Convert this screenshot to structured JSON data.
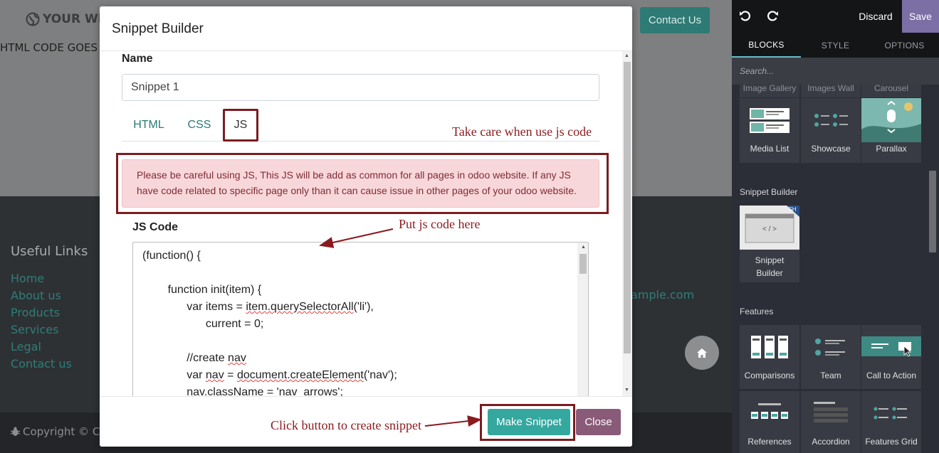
{
  "site": {
    "logo_text": "YOUR WEB",
    "html_placeholder_text": "HTML CODE GOES H",
    "contact_button": "Contact Us",
    "footer": {
      "useful_links_title": "Useful Links",
      "links": [
        "Home",
        "About us",
        "Products",
        "Services",
        "Legal",
        "Contact us"
      ],
      "email_fragment": "ample.com",
      "copyright": "Copyright © Co"
    }
  },
  "editor": {
    "discard": "Discard",
    "save": "Save",
    "tabs": [
      "BLOCKS",
      "STYLE",
      "OPTIONS"
    ],
    "search_placeholder": "Search...",
    "partial_blocks": [
      "Image Gallery",
      "Images Wall",
      "Carousel"
    ],
    "structure_blocks": [
      "Media List",
      "Showcase",
      "Parallax"
    ],
    "snippet_section": "Snippet Builder",
    "snippet_block": "Snippet Builder",
    "snippet_block_code": "< / >",
    "snippet_badge": "SH",
    "features_section": "Features",
    "features_row1": [
      "Comparisons",
      "Team",
      "Call to Action"
    ],
    "features_row2": [
      "References",
      "Accordion",
      "Features Grid"
    ],
    "colors": {
      "accent": "#7c6fa5",
      "active_tab_line": "#6bbcc9"
    }
  },
  "modal": {
    "title": "Snippet Builder",
    "name_label": "Name",
    "name_value": "Snippet 1",
    "tabs": {
      "html": "HTML",
      "css": "CSS",
      "js": "JS"
    },
    "alert": "Please be careful using JS, This JS will be add as common for all pages in odoo website. If any JS have code related to specific page only than it can cause issue in other pages of your odoo website.",
    "js_code_label": "JS Code",
    "code_lines": {
      "l1": "(function() {",
      "l2": "function init(item) {",
      "l3a": "var items = ",
      "l3b": "item.querySelectorAll",
      "l3c": "('li'),",
      "l4": "current = 0;",
      "l5a": "//create ",
      "l5b": "nav",
      "l6a": "var ",
      "l6b": "nav",
      "l6c": " = ",
      "l6d": "document.createElement",
      "l6e": "('nav');",
      "l7": "nav.className = 'nav_arrows';"
    },
    "make_button": "Make Snippet",
    "close_button": "Close"
  },
  "annotations": {
    "js_tab": "Take care when use js code",
    "code": "Put js code here",
    "button": "Click button to create snippet",
    "color": "#8b1a1e"
  }
}
